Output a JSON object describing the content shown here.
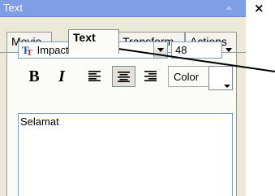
{
  "window": {
    "title": "Text"
  },
  "tabs": [
    {
      "label": "Movie"
    },
    {
      "label": "Text",
      "active": true
    },
    {
      "label": "Transform"
    },
    {
      "label": "Actions"
    }
  ],
  "font": {
    "name": "Impact",
    "size": "48"
  },
  "format": {
    "bold": "B",
    "italic": "I",
    "align_selected": "center",
    "color_label": "Color",
    "color_value": "#ffffff"
  },
  "text_content": "Selamat",
  "icons": [
    "scroll-up-icon",
    "close-icon",
    "truetype-font-icon",
    "align-left-icon",
    "align-center-icon",
    "align-right-icon",
    "dropdown-arrow-icon"
  ]
}
